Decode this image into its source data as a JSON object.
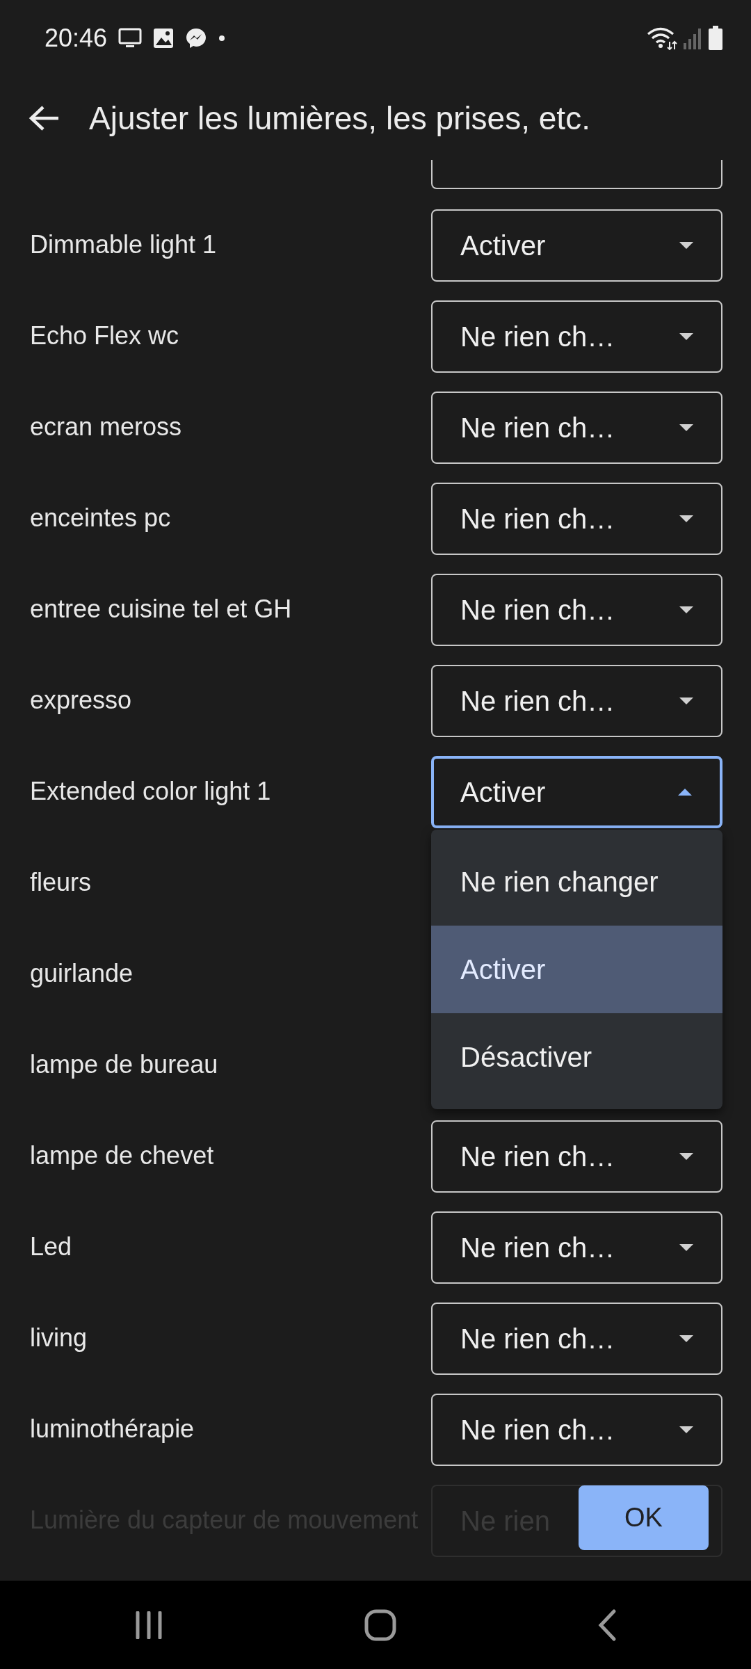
{
  "status_bar": {
    "time": "20:46"
  },
  "header": {
    "title": "Ajuster les lumières, les prises, etc."
  },
  "rows": [
    {
      "label": "Dimmable light 1",
      "dimmed": false,
      "select": {
        "value": "Activer",
        "expanded": false
      }
    },
    {
      "label": "Echo Flex wc",
      "dimmed": false,
      "select": {
        "value": "Ne rien ch…",
        "expanded": false
      }
    },
    {
      "label": "ecran meross",
      "dimmed": false,
      "select": {
        "value": "Ne rien ch…",
        "expanded": false
      }
    },
    {
      "label": "enceintes pc",
      "dimmed": false,
      "select": {
        "value": "Ne rien ch…",
        "expanded": false
      }
    },
    {
      "label": "entree cuisine tel et GH",
      "dimmed": false,
      "select": {
        "value": "Ne rien ch…",
        "expanded": false
      }
    },
    {
      "label": "expresso",
      "dimmed": false,
      "select": {
        "value": "Ne rien ch…",
        "expanded": false
      }
    },
    {
      "label": "Extended color light 1",
      "dimmed": false,
      "select": {
        "value": "Activer",
        "expanded": true,
        "options": [
          {
            "label": "Ne rien changer",
            "selected": false
          },
          {
            "label": "Activer",
            "selected": true
          },
          {
            "label": "Désactiver",
            "selected": false
          }
        ]
      }
    },
    {
      "label": "fleurs",
      "dimmed": false
    },
    {
      "label": "guirlande",
      "dimmed": false
    },
    {
      "label": "lampe de bureau",
      "dimmed": false
    },
    {
      "label": "lampe de chevet",
      "dimmed": false,
      "select": {
        "value": "Ne rien ch…",
        "expanded": false
      }
    },
    {
      "label": "Led",
      "dimmed": false,
      "select": {
        "value": "Ne rien ch…",
        "expanded": false
      }
    },
    {
      "label": "living",
      "dimmed": false,
      "select": {
        "value": "Ne rien ch…",
        "expanded": false
      }
    },
    {
      "label": "luminothérapie",
      "dimmed": false,
      "select": {
        "value": "Ne rien ch…",
        "expanded": false
      }
    },
    {
      "label": "Lumière du capteur de mouvement",
      "dimmed": true,
      "select": {
        "value": "Ne rien",
        "expanded": false
      }
    }
  ],
  "ok_button": {
    "label": "OK"
  }
}
